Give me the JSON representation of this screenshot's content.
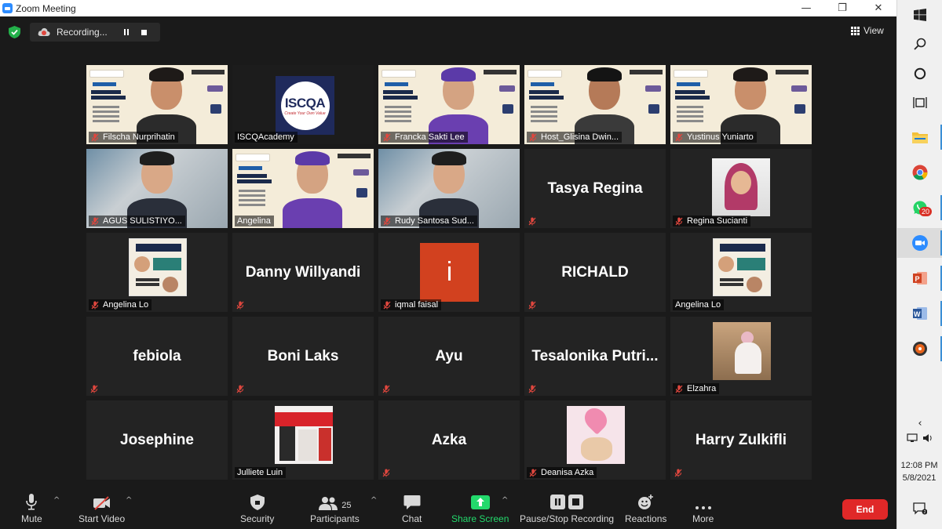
{
  "window": {
    "title": "Zoom Meeting"
  },
  "recording": {
    "label": "Recording..."
  },
  "view": {
    "label": "View"
  },
  "tiles": [
    {
      "name": "Filscha Nurprihatin",
      "kind": "video-slide",
      "muted": true,
      "row": 0,
      "col": 0
    },
    {
      "name": "ISCQAcademy",
      "kind": "logo",
      "muted": false,
      "active": true,
      "logo_text": "ISCQA",
      "logo_tagline": "Create Your Own Value",
      "row": 0,
      "col": 1
    },
    {
      "name": "Francka Sakti Lee",
      "kind": "video-slide",
      "muted": true,
      "row": 0,
      "col": 2
    },
    {
      "name": "Host_Glisina Dwin...",
      "kind": "video-slide",
      "muted": true,
      "row": 0,
      "col": 3
    },
    {
      "name": "Yustinus Yuniarto",
      "kind": "video-slide",
      "muted": true,
      "row": 0,
      "col": 4
    },
    {
      "name": "AGUS SULISTIYO...",
      "kind": "video-room",
      "muted": true,
      "row": 1,
      "col": 0
    },
    {
      "name": "Angelina",
      "kind": "video-slide",
      "muted": false,
      "row": 1,
      "col": 1
    },
    {
      "name": "Rudy Santosa Sud...",
      "kind": "video-room",
      "muted": true,
      "row": 1,
      "col": 2
    },
    {
      "name": "",
      "display_name": "Tasya Regina",
      "kind": "name",
      "muted": true,
      "row": 1,
      "col": 3
    },
    {
      "name": "Regina Sucianti",
      "kind": "photo",
      "muted": true,
      "row": 1,
      "col": 4
    },
    {
      "name": "Angelina Lo",
      "kind": "poster",
      "muted": true,
      "row": 2,
      "col": 0
    },
    {
      "name": "",
      "display_name": "Danny Willyandi",
      "kind": "name",
      "muted": true,
      "row": 2,
      "col": 1
    },
    {
      "name": "iqmal faisal",
      "kind": "letter",
      "letter": "i",
      "muted": true,
      "row": 2,
      "col": 2
    },
    {
      "name": "",
      "display_name": "RICHALD",
      "kind": "name",
      "muted": true,
      "row": 2,
      "col": 3
    },
    {
      "name": "Angelina Lo",
      "kind": "poster",
      "muted": false,
      "row": 2,
      "col": 4
    },
    {
      "name": "",
      "display_name": "febiola",
      "kind": "name",
      "muted": true,
      "row": 3,
      "col": 0
    },
    {
      "name": "",
      "display_name": "Boni Laks",
      "kind": "name",
      "muted": true,
      "row": 3,
      "col": 1
    },
    {
      "name": "",
      "display_name": "Ayu",
      "kind": "name",
      "muted": true,
      "row": 3,
      "col": 2
    },
    {
      "name": "",
      "display_name": "Tesalonika  Putri...",
      "kind": "name",
      "muted": true,
      "row": 3,
      "col": 3
    },
    {
      "name": "Elzahra",
      "kind": "photo-outdoor",
      "muted": true,
      "row": 3,
      "col": 4
    },
    {
      "name": "",
      "display_name": "Josephine",
      "kind": "name",
      "muted": false,
      "row": 4,
      "col": 0
    },
    {
      "name": "Julliete Luin",
      "kind": "photo-red",
      "muted": false,
      "row": 4,
      "col": 1
    },
    {
      "name": "",
      "display_name": "Azka",
      "kind": "name",
      "muted": true,
      "row": 4,
      "col": 2
    },
    {
      "name": "Deanisa Azka",
      "kind": "photo-pink",
      "muted": true,
      "row": 4,
      "col": 3
    },
    {
      "name": "",
      "display_name": "Harry Zulkifli",
      "kind": "name",
      "muted": true,
      "row": 4,
      "col": 4
    }
  ],
  "toolbar": {
    "mute": "Mute",
    "start_video": "Start Video",
    "security": "Security",
    "participants": "Participants",
    "participants_count": "25",
    "chat": "Chat",
    "share_screen": "Share Screen",
    "pause_stop_recording": "Pause/Stop Recording",
    "reactions": "Reactions",
    "more": "More",
    "end": "End"
  },
  "taskbar": {
    "time": "12:08 PM",
    "date": "5/8/2021",
    "whatsapp_badge": "20"
  },
  "colors": {
    "active_outline": "#c9d84a",
    "share_green": "#23d96c",
    "end_red": "#e02828",
    "muted_red": "#e0473e"
  }
}
